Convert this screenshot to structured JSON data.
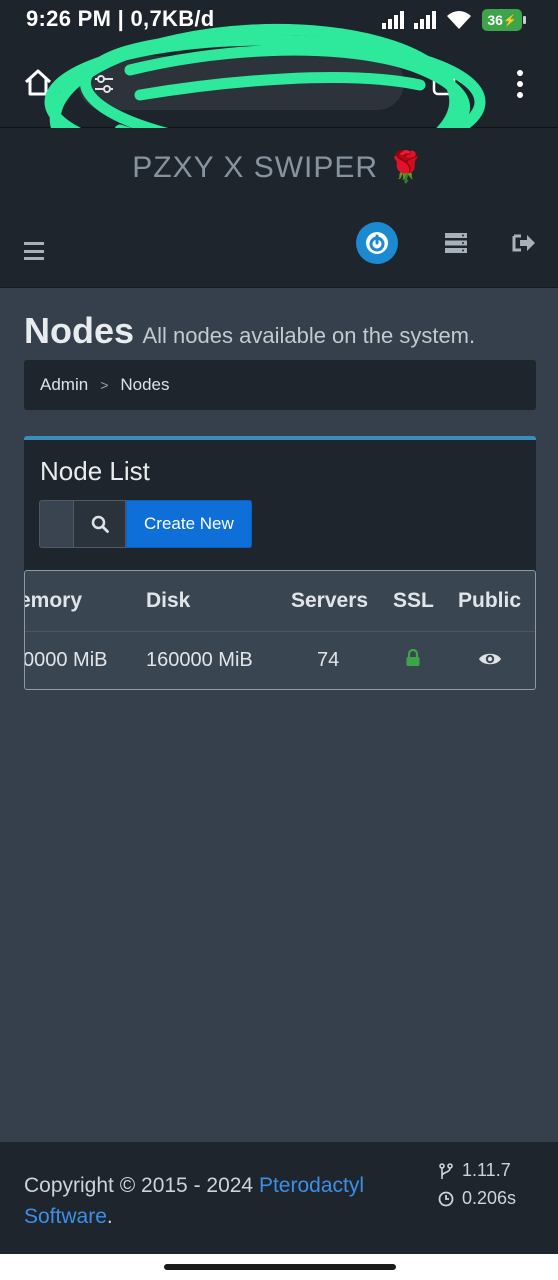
{
  "status_bar": {
    "time": "9:26 PM | 0,7KB/d",
    "battery": "36"
  },
  "browser": {
    "url": ""
  },
  "site": {
    "brand": "PZXY X SWIPER 🌹"
  },
  "page": {
    "title": "Nodes",
    "subtitle": "All nodes available on the system."
  },
  "breadcrumb": {
    "items": [
      "Admin",
      "Nodes"
    ],
    "separator": ">"
  },
  "node_list": {
    "title": "Node List",
    "create_label": "Create New",
    "columns": [
      "emory",
      "Disk",
      "Servers",
      "SSL",
      "Public"
    ],
    "rows": [
      {
        "memory": "0000 MiB",
        "disk": "160000 MiB",
        "servers": "74"
      }
    ]
  },
  "footer": {
    "copyright": "Copyright © 2015 - 2024",
    "link_text": "Pterodactyl Software",
    "period": ".",
    "version": "1.11.7",
    "time": "0.206s"
  },
  "colors": {
    "accent": "#3c8dbc",
    "primary_button": "#0f6fd8",
    "link": "#3b8fe8",
    "ssl_lock": "#3ea449"
  },
  "icons": [
    "home-icon",
    "tune-icon",
    "tabs-icon",
    "more-vert-icon",
    "hamburger-icon",
    "power-icon",
    "servers-icon",
    "logout-icon",
    "search-icon",
    "lock-icon",
    "eye-icon",
    "branch-icon",
    "clock-icon"
  ]
}
